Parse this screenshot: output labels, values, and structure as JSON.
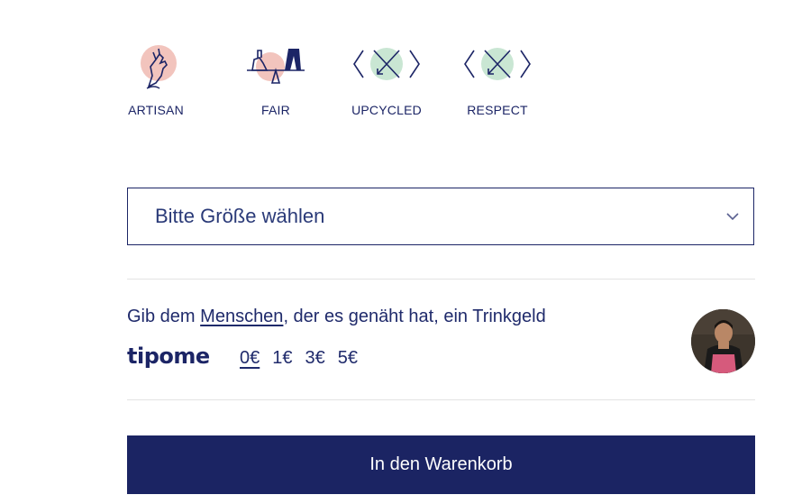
{
  "badges": [
    {
      "icon": "artisan-hand-icon",
      "label": "ARTISAN"
    },
    {
      "icon": "fair-scale-icon",
      "label": "FAIR"
    },
    {
      "icon": "upcycled-arrows-icon",
      "label": "UPCYCLED"
    },
    {
      "icon": "respect-arrows-icon",
      "label": "RESPECT"
    }
  ],
  "size_select": {
    "value": "Bitte Größe wählen",
    "icon": "chevron-down-icon"
  },
  "tip": {
    "text_before": "Gib dem ",
    "link_text": "Menschen",
    "text_after": ", der es genäht hat, ein Trinkgeld",
    "logo": "tipome",
    "amounts": [
      "0€",
      "1€",
      "3€",
      "5€"
    ],
    "selected_amount": "0€"
  },
  "colors": {
    "brand_navy": "#1b2463",
    "badge_pink": "#f2c4bd",
    "badge_green": "#c9e6d3"
  },
  "cart_button": {
    "label": "In den Warenkorb"
  }
}
